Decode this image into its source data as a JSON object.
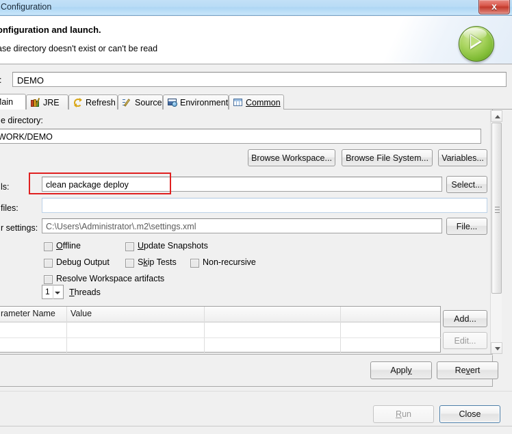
{
  "window": {
    "title": "t Configuration",
    "close_label": "x"
  },
  "header": {
    "title": "onfiguration and launch.",
    "subtitle": "ase directory doesn't exist or can't be read",
    "run_icon": "run-green-play-icon"
  },
  "name_row": {
    "label": "e:",
    "value": "DEMO"
  },
  "tabs": [
    {
      "label": "Main",
      "icon": "",
      "active": true
    },
    {
      "label": "JRE",
      "icon": "jre-books-icon",
      "active": false
    },
    {
      "label": "Refresh",
      "icon": "refresh-arrows-icon",
      "active": false
    },
    {
      "label": "Source",
      "icon": "source-pencil-icon",
      "active": false
    },
    {
      "label": "Environment",
      "icon": "environment-monitor-icon",
      "active": false
    },
    {
      "label": "Common",
      "icon": "common-table-icon",
      "active": false
    }
  ],
  "main": {
    "base_directory_label": "e directory:",
    "base_directory_value": "WORK/DEMO",
    "browse_workspace_label": "Browse Workspace...",
    "browse_file_system_label": "Browse File System...",
    "variables_label": "Variables...",
    "goals_label": "ls:",
    "goals_value": "clean package deploy",
    "select_label": "Select...",
    "profiles_label": "files:",
    "profiles_value": "",
    "user_settings_label": "r settings:",
    "user_settings_value": "C:\\Users\\Administrator\\.m2\\settings.xml",
    "file_label": "File...",
    "checkboxes": [
      {
        "label": "Offline",
        "checked": false
      },
      {
        "label": "Update Snapshots",
        "checked": false
      },
      {
        "label": "Debug Output",
        "checked": false
      },
      {
        "label": "Skip Tests",
        "checked": false
      },
      {
        "label": "Non-recursive",
        "checked": false
      },
      {
        "label": "Resolve Workspace artifacts",
        "checked": false
      }
    ],
    "threads_value": "1",
    "threads_label": "Threads",
    "table": {
      "columns": [
        "rameter Name",
        "Value"
      ],
      "rows": [
        {
          "name": "",
          "value": ""
        },
        {
          "name": "",
          "value": ""
        }
      ]
    },
    "add_label": "Add...",
    "edit_label": "Edit..."
  },
  "footer": {
    "apply_label": "Apply",
    "revert_label": "Revert",
    "run_label": "Run",
    "close_label": "Close"
  },
  "colors": {
    "titlebar": "#b9dcf6",
    "close_red": "#c33a2c",
    "highlight_red": "#e02020",
    "run_green": "#7fbb34",
    "panel_bg": "#f0f0f0"
  }
}
